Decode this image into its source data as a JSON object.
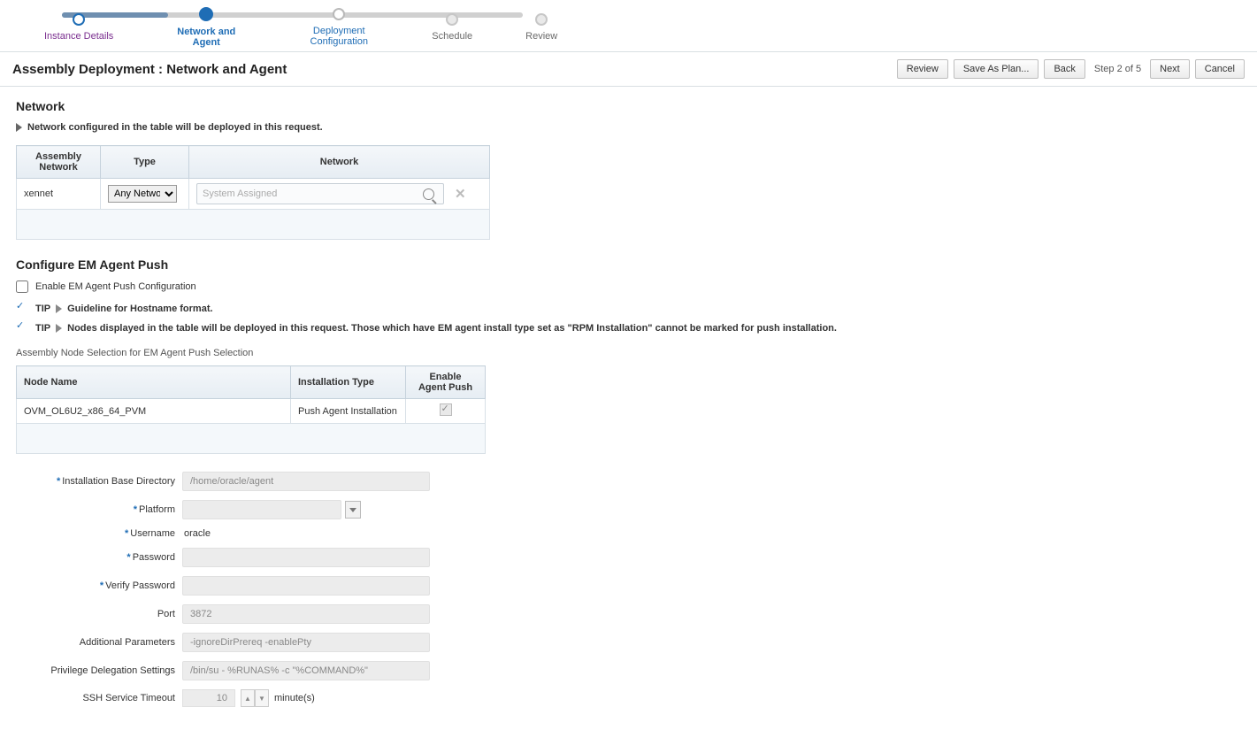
{
  "wizard": {
    "steps": [
      {
        "label": "Instance Details",
        "state": "completed"
      },
      {
        "label": "Network and Agent",
        "state": "current"
      },
      {
        "label": "Deployment Configuration",
        "state": "link"
      },
      {
        "label": "Schedule",
        "state": "future"
      },
      {
        "label": "Review",
        "state": "future"
      }
    ]
  },
  "header": {
    "title": "Assembly Deployment : Network and Agent",
    "buttons": {
      "review": "Review",
      "saveAsPlan": "Save As Plan...",
      "back": "Back",
      "stepCounter": "Step 2 of 5",
      "next": "Next",
      "cancel": "Cancel"
    }
  },
  "network": {
    "title": "Network",
    "expanderText": "Network configured in the table will be deployed in this request.",
    "columns": {
      "assemblyNetwork": "Assembly Network",
      "type": "Type",
      "network": "Network"
    },
    "row": {
      "assemblyNetwork": "xennet",
      "typeOptions": [
        "Any Network"
      ],
      "typeSelected": "Any Network",
      "networkPlaceholder": "System Assigned"
    }
  },
  "agent": {
    "title": "Configure EM Agent Push",
    "enableLabel": "Enable EM Agent Push Configuration",
    "tip1": "Guideline for Hostname format.",
    "tip2": "Nodes displayed in the table will be deployed in this request. Those which have EM agent install type set as \"RPM Installation\" cannot be marked for push installation.",
    "tipLabel": "TIP",
    "tableSubtitle": "Assembly Node Selection for EM Agent Push Selection",
    "columns": {
      "nodeName": "Node Name",
      "installType": "Installation Type",
      "enablePush": "Enable Agent Push"
    },
    "row": {
      "nodeName": "OVM_OL6U2_x86_64_PVM",
      "installType": "Push Agent Installation"
    }
  },
  "form": {
    "labels": {
      "installDir": "Installation Base Directory",
      "platform": "Platform",
      "username": "Username",
      "password": "Password",
      "verifyPassword": "Verify Password",
      "port": "Port",
      "additionalParams": "Additional Parameters",
      "privDelegation": "Privilege Delegation Settings",
      "sshTimeout": "SSH Service Timeout"
    },
    "values": {
      "installDir": "/home/oracle/agent",
      "platform": "",
      "username": "oracle",
      "password": "",
      "verifyPassword": "",
      "port": "3872",
      "additionalParams": "-ignoreDirPrereq -enablePty",
      "privDelegation": "/bin/su - %RUNAS% -c \"%COMMAND%\"",
      "sshTimeout": "10",
      "sshUnit": "minute(s)"
    }
  }
}
